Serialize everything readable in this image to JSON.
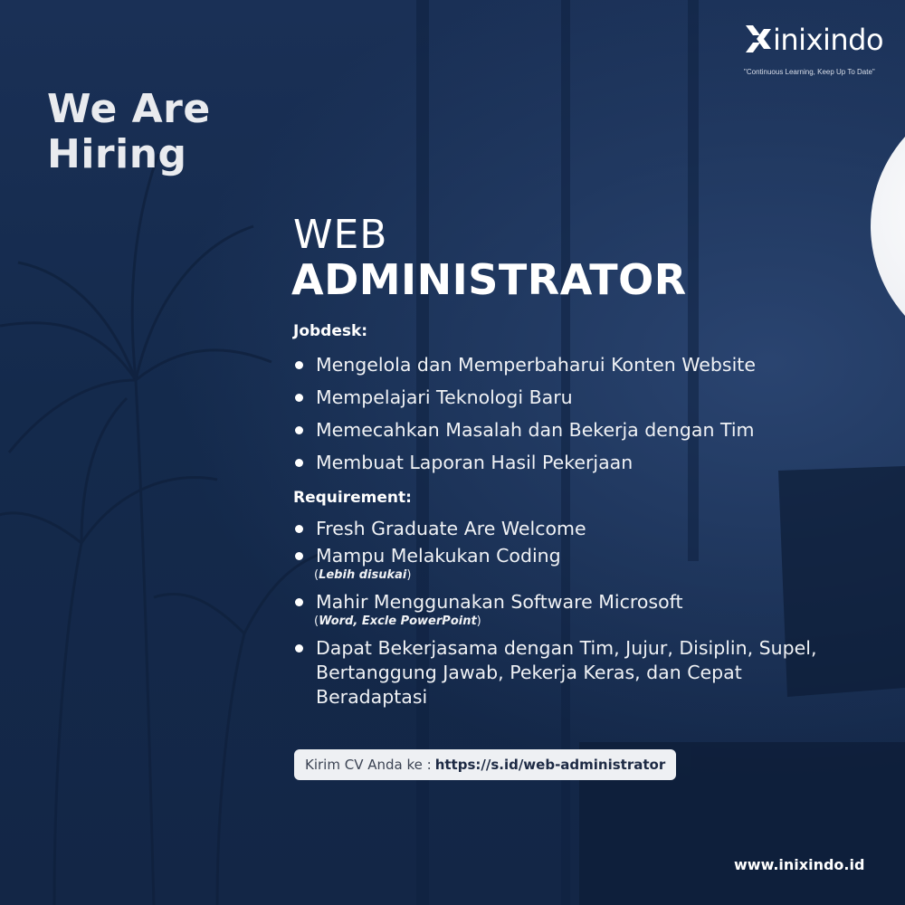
{
  "brand": {
    "name": "inixindo",
    "tagline": "\"Continuous Learning, Keep Up To Date\"",
    "icon": "inixindo-x-logo-icon",
    "website": "www.inixindo.id"
  },
  "headline": {
    "line1": "We Are",
    "line2": "Hiring"
  },
  "position": {
    "line1": "WEB",
    "line2": "ADMINISTRATOR"
  },
  "jobdesk": {
    "heading": "Jobdesk:",
    "items": [
      "Mengelola dan Memperbaharui Konten Website",
      "Mempelajari Teknologi Baru",
      "Memecahkan Masalah dan Bekerja dengan Tim",
      "Membuat Laporan Hasil Pekerjaan"
    ]
  },
  "requirement": {
    "heading": "Requirement:",
    "items": [
      {
        "text": "Fresh Graduate Are Welcome"
      },
      {
        "text": "Mampu Melakukan Coding",
        "note": "Lebih disukai"
      },
      {
        "text": "Mahir Menggunakan Software Microsoft",
        "note": "Word, Excle PowerPoint"
      },
      {
        "text": "Dapat Bekerjasama dengan Tim, Jujur, Disiplin, Supel, Bertanggung Jawab, Pekerja Keras, dan Cepat Beradaptasi"
      }
    ]
  },
  "cta": {
    "label": "Kirim CV Anda ke :",
    "url": "https://s.id/web-administrator"
  },
  "colors": {
    "background": "#14284a",
    "text": "#ffffff",
    "cta_background": "#eef0f3"
  }
}
